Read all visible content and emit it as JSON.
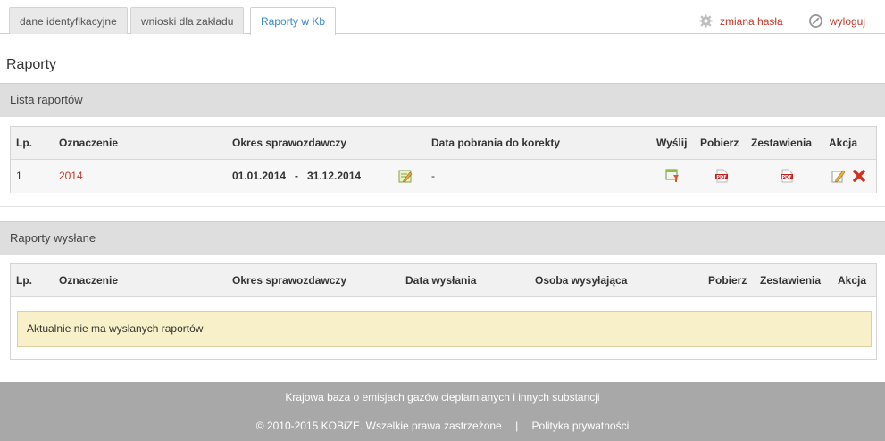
{
  "tabs": [
    {
      "label": "dane identyfikacyjne"
    },
    {
      "label": "wnioski dla zakładu"
    },
    {
      "label": "Raporty w Kb"
    }
  ],
  "top_links": {
    "password_change": "zmiana hasła",
    "logout": "wyloguj"
  },
  "page_title": "Raporty",
  "reports_list": {
    "header": "Lista raportów",
    "columns": [
      "Lp.",
      "Oznaczenie",
      "Okres sprawozdawczy",
      "Data pobrania do korekty",
      "Wyślij",
      "Pobierz",
      "Zestawienia",
      "Akcja"
    ],
    "rows": [
      {
        "lp": "1",
        "designation": "2014",
        "period_from": "01.01.2014",
        "period_sep": "-",
        "period_to": "31.12.2014",
        "download_date": "-"
      }
    ]
  },
  "sent_reports": {
    "header": "Raporty wysłane",
    "columns": [
      "Lp.",
      "Oznaczenie",
      "Okres sprawozdawczy",
      "Data wysłania",
      "Osoba wysyłająca",
      "Pobierz",
      "Zestawienia",
      "Akcja"
    ],
    "empty_message": "Aktualnie nie ma wysłanych raportów"
  },
  "footer": {
    "line1": "Krajowa baza o emisjach gazów cieplarnianych i innych substancji",
    "copyright": "© 2010-2015 KOBiZE. Wszelkie prawa zastrzeżone",
    "separator": "|",
    "privacy": "Polityka prywatności"
  },
  "colors": {
    "accent_link": "#c0392b",
    "active_tab": "#3a87c8",
    "header_bg": "#dedede",
    "notice_bg": "#f8f0c8",
    "footer_bg": "#a8a8a8"
  },
  "icons": {
    "password_change": "gear-icon",
    "logout": "power-icon",
    "edit_period": "edit-note-icon",
    "send": "send-down-icon",
    "download": "pdf-icon",
    "summary": "pdf-icon",
    "edit": "pencil-icon",
    "delete": "delete-x-icon"
  }
}
